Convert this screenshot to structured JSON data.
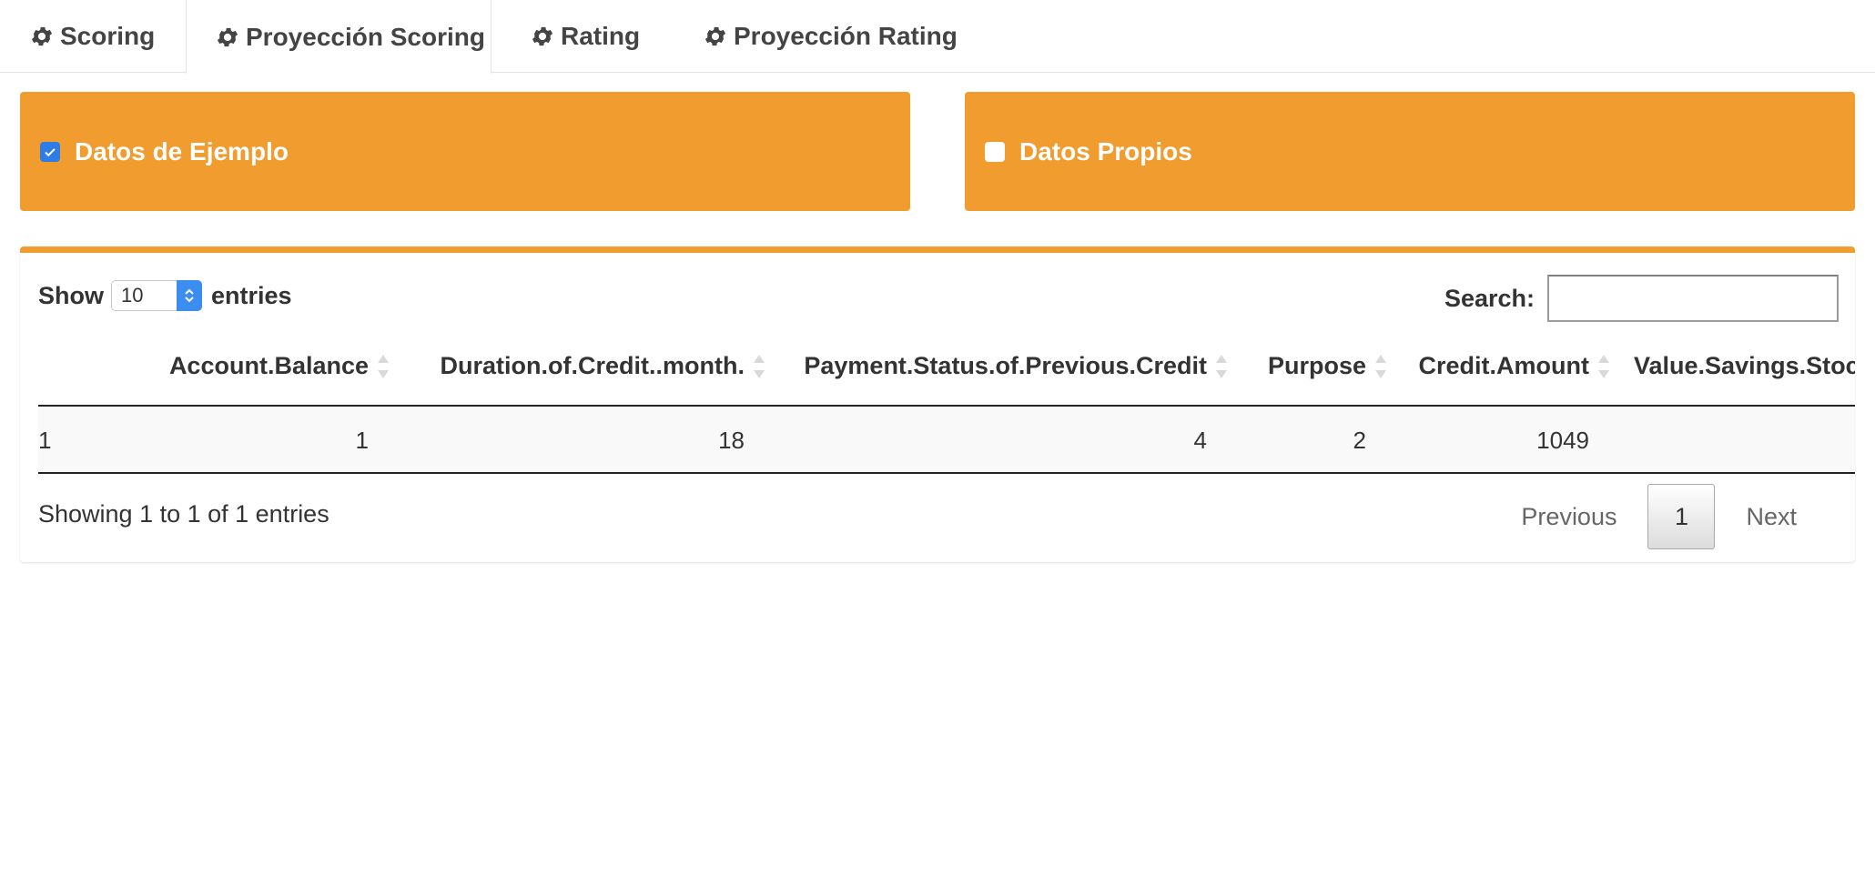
{
  "tabs": [
    {
      "label": "Scoring",
      "icon": "gear-icon",
      "active": false
    },
    {
      "label": "Proyección Scoring",
      "icon": "gear-icon",
      "active": true
    },
    {
      "label": "Rating",
      "icon": "gear-icon",
      "active": false
    },
    {
      "label": "Proyección Rating",
      "icon": "gear-icon",
      "active": false
    }
  ],
  "data_source": {
    "example": {
      "label": "Datos de Ejemplo",
      "checked": true
    },
    "own": {
      "label": "Datos Propios",
      "checked": false
    }
  },
  "table": {
    "length_prefix": "Show",
    "length_value": "10",
    "length_suffix": "entries",
    "search_label": "Search:",
    "search_value": "",
    "columns": [
      "",
      "Account.Balance",
      "Duration.of.Credit..month.",
      "Payment.Status.of.Previous.Credit",
      "Purpose",
      "Credit.Amount",
      "Value.Savings.Stocks"
    ],
    "rows": [
      [
        "1",
        "1",
        "18",
        "4",
        "2",
        "1049",
        ""
      ]
    ],
    "info": "Showing 1 to 1 of 1 entries",
    "pagination": {
      "previous": "Previous",
      "current_page": "1",
      "next": "Next"
    }
  },
  "colors": {
    "accent": "#f09c2e",
    "checkbox_checked": "#2e7de6"
  }
}
